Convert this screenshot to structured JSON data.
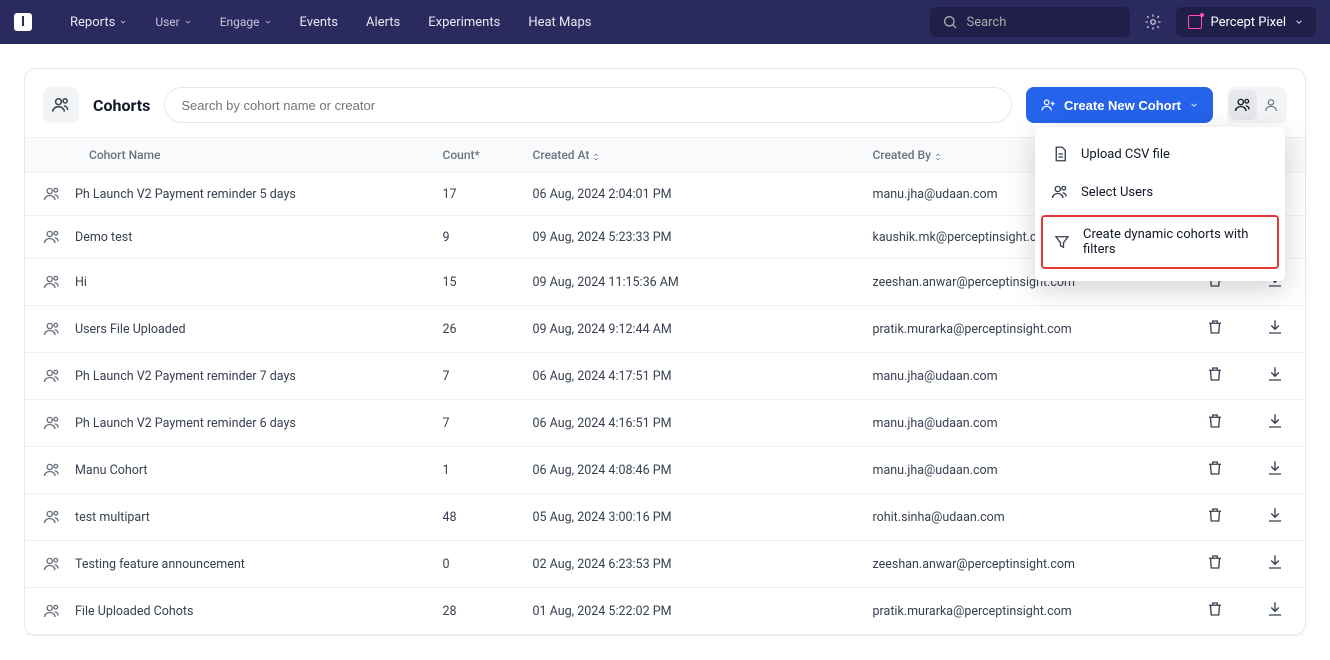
{
  "nav": {
    "items": [
      "Reports",
      "User",
      "Engage",
      "Events",
      "Alerts",
      "Experiments",
      "Heat Maps"
    ],
    "search_placeholder": "Search",
    "workspace": "Percept Pixel"
  },
  "page": {
    "title": "Cohorts",
    "search_placeholder": "Search by cohort name or creator",
    "create_label": "Create New Cohort"
  },
  "dropdown": {
    "upload": "Upload CSV file",
    "select_users": "Select Users",
    "dynamic": "Create dynamic cohorts with filters"
  },
  "columns": {
    "name": "Cohort Name",
    "count": "Count*",
    "created_at": "Created At",
    "created_by": "Created By"
  },
  "rows": [
    {
      "name": "Ph Launch V2 Payment reminder 5 days",
      "count": "17",
      "created_at": "06 Aug, 2024 2:04:01 PM",
      "created_by": "manu.jha@udaan.com"
    },
    {
      "name": "Demo test",
      "count": "9",
      "created_at": "09 Aug, 2024 5:23:33 PM",
      "created_by": "kaushik.mk@perceptinsight.com"
    },
    {
      "name": "Hi",
      "count": "15",
      "created_at": "09 Aug, 2024 11:15:36 AM",
      "created_by": "zeeshan.anwar@perceptinsight.com"
    },
    {
      "name": "Users File Uploaded",
      "count": "26",
      "created_at": "09 Aug, 2024 9:12:44 AM",
      "created_by": "pratik.murarka@perceptinsight.com"
    },
    {
      "name": "Ph Launch V2 Payment reminder 7 days",
      "count": "7",
      "created_at": "06 Aug, 2024 4:17:51 PM",
      "created_by": "manu.jha@udaan.com"
    },
    {
      "name": "Ph Launch V2 Payment reminder 6 days",
      "count": "7",
      "created_at": "06 Aug, 2024 4:16:51 PM",
      "created_by": "manu.jha@udaan.com"
    },
    {
      "name": "Manu Cohort",
      "count": "1",
      "created_at": "06 Aug, 2024 4:08:46 PM",
      "created_by": "manu.jha@udaan.com"
    },
    {
      "name": "test multipart",
      "count": "48",
      "created_at": "05 Aug, 2024 3:00:16 PM",
      "created_by": "rohit.sinha@udaan.com"
    },
    {
      "name": "Testing feature announcement",
      "count": "0",
      "created_at": "02 Aug, 2024 6:23:53 PM",
      "created_by": "zeeshan.anwar@perceptinsight.com"
    },
    {
      "name": "File Uploaded Cohots",
      "count": "28",
      "created_at": "01 Aug, 2024 5:22:02 PM",
      "created_by": "pratik.murarka@perceptinsight.com"
    }
  ]
}
